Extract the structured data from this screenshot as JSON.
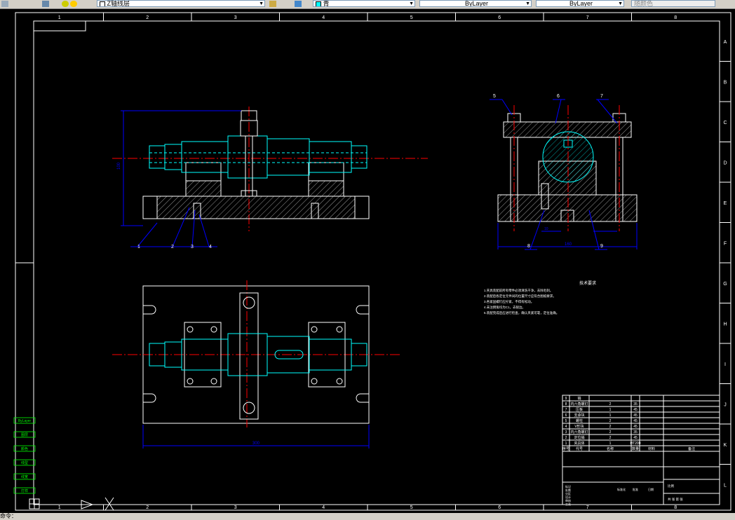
{
  "toolbar": {
    "layer_combo": "Z轴线层",
    "color_combo": "青",
    "linetype_combo": "ByLayer",
    "lineweight_combo": "ByLayer",
    "plotstyle_combo": "随颜色"
  },
  "frame": {
    "columns": [
      "1",
      "2",
      "3",
      "4",
      "5",
      "6",
      "7",
      "8"
    ],
    "rows": [
      "A",
      "B",
      "C",
      "D",
      "E",
      "F",
      "G",
      "H",
      "I",
      "J",
      "K",
      "L"
    ]
  },
  "balloons": {
    "front": [
      "1",
      "2",
      "3",
      "4"
    ],
    "side": [
      "5",
      "6",
      "7",
      "8",
      "9"
    ]
  },
  "dims": {
    "front_height": "100",
    "plan_width": "300",
    "side_width": "160",
    "side_small": "10"
  },
  "notes": {
    "title": "技术要求",
    "lines": [
      "1.夹具装配前所有零件必须清洗干净，去除毛刺。",
      "2.装配后各定位元件间的位置尺寸应符合图纸要求。",
      "3.各紧固螺钉应拧紧，不得有松动。",
      "4.未注倒角均为C1，去锐边。",
      "5.装配完成后应进行检查，确认夹紧可靠，定位准确。"
    ]
  },
  "bom": {
    "rows": [
      [
        "9",
        "销",
        "",
        "",
        "",
        ""
      ],
      [
        "8",
        "内六角螺钉",
        "2",
        "35",
        "",
        ""
      ],
      [
        "7",
        "压板",
        "1",
        "45",
        "",
        ""
      ],
      [
        "6",
        "支承块",
        "1",
        "45",
        "",
        ""
      ],
      [
        "5",
        "螺柱",
        "2",
        "45",
        "",
        ""
      ],
      [
        "4",
        "V形块",
        "2",
        "45",
        "",
        ""
      ],
      [
        "3",
        "内六角螺钉",
        "2",
        "35",
        "",
        ""
      ],
      [
        "2",
        "定位销",
        "2",
        "45",
        "",
        ""
      ],
      [
        "1",
        "夹具体",
        "1",
        "HT200",
        "",
        ""
      ]
    ],
    "header": [
      "序号",
      "代号",
      "名称",
      "数量",
      "材料",
      "备注"
    ],
    "title_left": [
      "标记",
      "处数",
      "分区",
      "设计",
      "审核",
      "工艺"
    ],
    "title_mid": [
      "标准化",
      "批准",
      "日期"
    ],
    "scale_label": "比例",
    "sheet_label": "共  张  第  张"
  },
  "sidebar_labels": [
    "ByLayer",
    "图层",
    "颜色",
    "线型",
    "线宽",
    "打样"
  ],
  "status": {
    "prompt": "命令："
  },
  "colors": {
    "cyan": "#00ffff",
    "white": "#ffffff",
    "red": "#ff0000",
    "blue": "#0000ff",
    "green": "#00ff00"
  }
}
